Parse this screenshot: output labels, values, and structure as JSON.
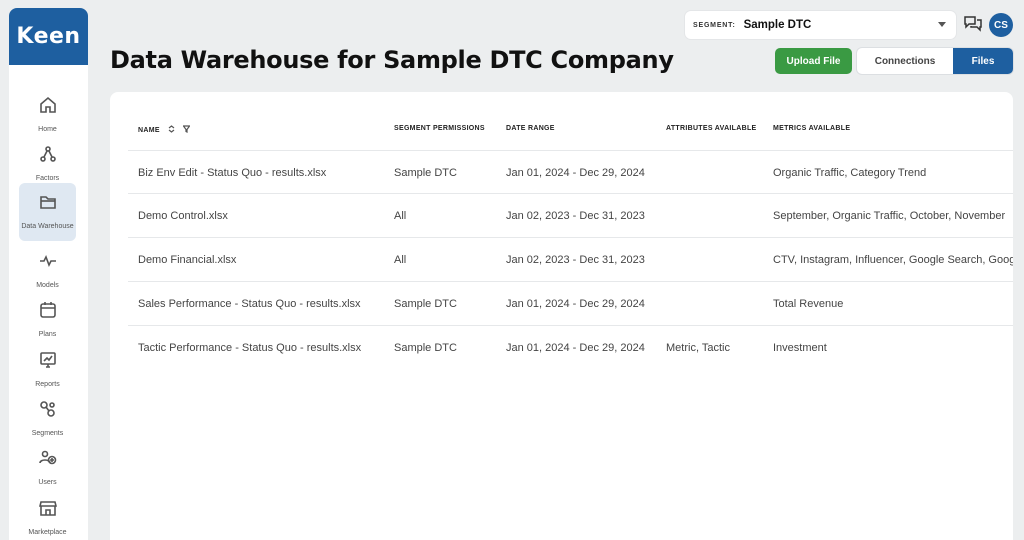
{
  "app": {
    "logo": "Keen"
  },
  "sidebar": {
    "items": [
      {
        "label": "Home",
        "icon": "home-icon"
      },
      {
        "label": "Factors",
        "icon": "factors-icon"
      },
      {
        "label": "Data Warehouse",
        "icon": "folder-icon",
        "active": true
      },
      {
        "label": "Models",
        "icon": "pulse-icon"
      },
      {
        "label": "Plans",
        "icon": "calendar-icon"
      },
      {
        "label": "Reports",
        "icon": "chart-icon"
      },
      {
        "label": "Segments",
        "icon": "segments-icon"
      },
      {
        "label": "Users",
        "icon": "users-icon"
      },
      {
        "label": "Marketplace",
        "icon": "store-icon"
      }
    ]
  },
  "header": {
    "segment_label": "SEGMENT:",
    "segment_value": "Sample DTC",
    "avatar_initials": "CS",
    "title": "Data Warehouse for Sample DTC Company",
    "upload_label": "Upload File",
    "toggle": {
      "connections": "Connections",
      "files": "Files"
    }
  },
  "table": {
    "columns": {
      "name": "NAME",
      "permissions": "SEGMENT PERMISSIONS",
      "date_range": "DATE RANGE",
      "attributes": "ATTRIBUTES AVAILABLE",
      "metrics": "METRICS AVAILABLE"
    },
    "rows": [
      {
        "name": "Biz Env Edit - Status Quo - results.xlsx",
        "permissions": "Sample DTC",
        "date_range": "Jan 01, 2024 - Dec 29, 2024",
        "attributes": "",
        "metrics": "Organic Traffic, Category Trend"
      },
      {
        "name": "Demo Control.xlsx",
        "permissions": "All",
        "date_range": "Jan 02, 2023 - Dec 31, 2023",
        "attributes": "",
        "metrics": "September, Organic Traffic, October, November"
      },
      {
        "name": "Demo Financial.xlsx",
        "permissions": "All",
        "date_range": "Jan 02, 2023 - Dec 31, 2023",
        "attributes": "",
        "metrics": "CTV, Instagram, Influencer, Google Search, Google"
      },
      {
        "name": "Sales Performance - Status Quo - results.xlsx",
        "permissions": "Sample DTC",
        "date_range": "Jan 01, 2024 - Dec 29, 2024",
        "attributes": "",
        "metrics": "Total Revenue"
      },
      {
        "name": "Tactic Performance - Status Quo - results.xlsx",
        "permissions": "Sample DTC",
        "date_range": "Jan 01, 2024 - Dec 29, 2024",
        "attributes": "Metric, Tactic",
        "metrics": "Investment"
      }
    ]
  },
  "colors": {
    "brand": "#1e5fa0",
    "upload": "#3a9a43",
    "background": "#eceeef"
  }
}
